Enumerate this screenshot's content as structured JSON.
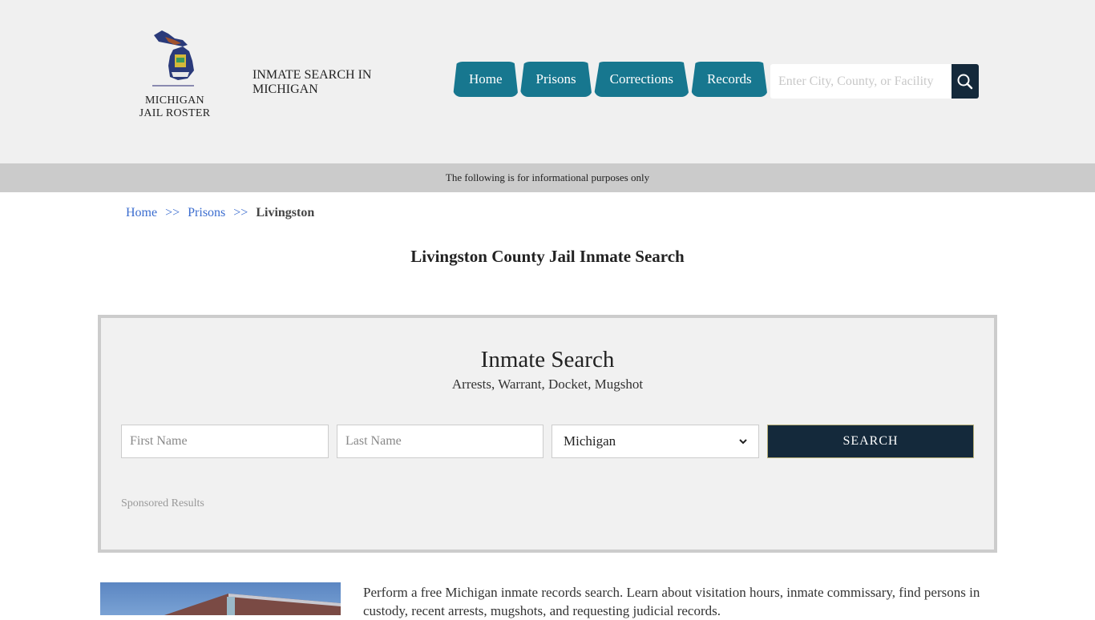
{
  "header": {
    "logo_line1": "MICHIGAN",
    "logo_line2": "JAIL ROSTER",
    "site_title": "INMATE SEARCH IN MICHIGAN",
    "nav": [
      {
        "label": "Home"
      },
      {
        "label": "Prisons"
      },
      {
        "label": "Corrections"
      },
      {
        "label": "Records"
      }
    ],
    "search": {
      "placeholder": "Enter City, County, or Facility",
      "value": "",
      "icon": "search-icon"
    }
  },
  "notice": "The following is for informational purposes only",
  "breadcrumb": {
    "items": [
      "Home",
      "Prisons"
    ],
    "separator": ">>",
    "current": "Livingston"
  },
  "page_title": "Livingston County Jail Inmate Search",
  "inmate_search": {
    "title": "Inmate Search",
    "subtitle": "Arrests, Warrant, Docket, Mugshot",
    "first_name_placeholder": "First Name",
    "last_name_placeholder": "Last Name",
    "state_selected": "Michigan",
    "search_label": "SEARCH",
    "sponsored": "Sponsored Results"
  },
  "intro": {
    "text": "Perform a free Michigan inmate records search. Learn about visitation hours, inmate commissary, find persons in custody, recent arrests, mugshots, and requesting judicial records."
  },
  "colors": {
    "nav_bg": "#17778f",
    "dark_navy": "#14293b",
    "link": "#3a6ccf",
    "notice_bg": "#cbcbcb",
    "header_bg": "#f0f0f0"
  }
}
